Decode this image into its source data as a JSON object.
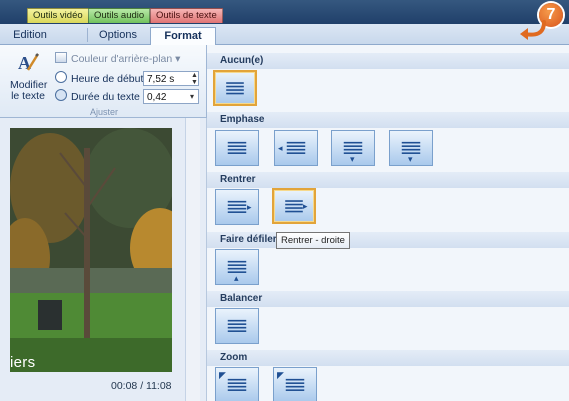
{
  "contextual_tabs": {
    "video": "Outils vidéo",
    "audio": "Outils audio",
    "text": "Outils de texte"
  },
  "tabs": [
    "Edition",
    "Options",
    "Format"
  ],
  "active_tab": "Format",
  "ribbon": {
    "edit_button_label": "Modifier le texte",
    "background_color_label": "Couleur d'arrière-plan",
    "start_time_label": "Heure de début :",
    "start_time_value": "7,52 s",
    "duration_label": "Durée du texte :",
    "duration_value": "0,42",
    "group_label": "Ajuster"
  },
  "preview": {
    "caption": "iers",
    "time": "00:08 / 11:08"
  },
  "gallery": {
    "sections": [
      {
        "title": "Aucun(e)",
        "items": 1
      },
      {
        "title": "Emphase",
        "items": 4
      },
      {
        "title": "Rentrer",
        "items": 2
      },
      {
        "title": "Faire défiler",
        "items": 1
      },
      {
        "title": "Balancer",
        "items": 1
      },
      {
        "title": "Zoom",
        "items": 2
      }
    ],
    "tooltip": "Rentrer - droite"
  },
  "badge": "7",
  "colors": {
    "accent_orange": "#e2a43a",
    "badge": "#d9551c",
    "ribbon_blue": "#dfe9f5"
  }
}
